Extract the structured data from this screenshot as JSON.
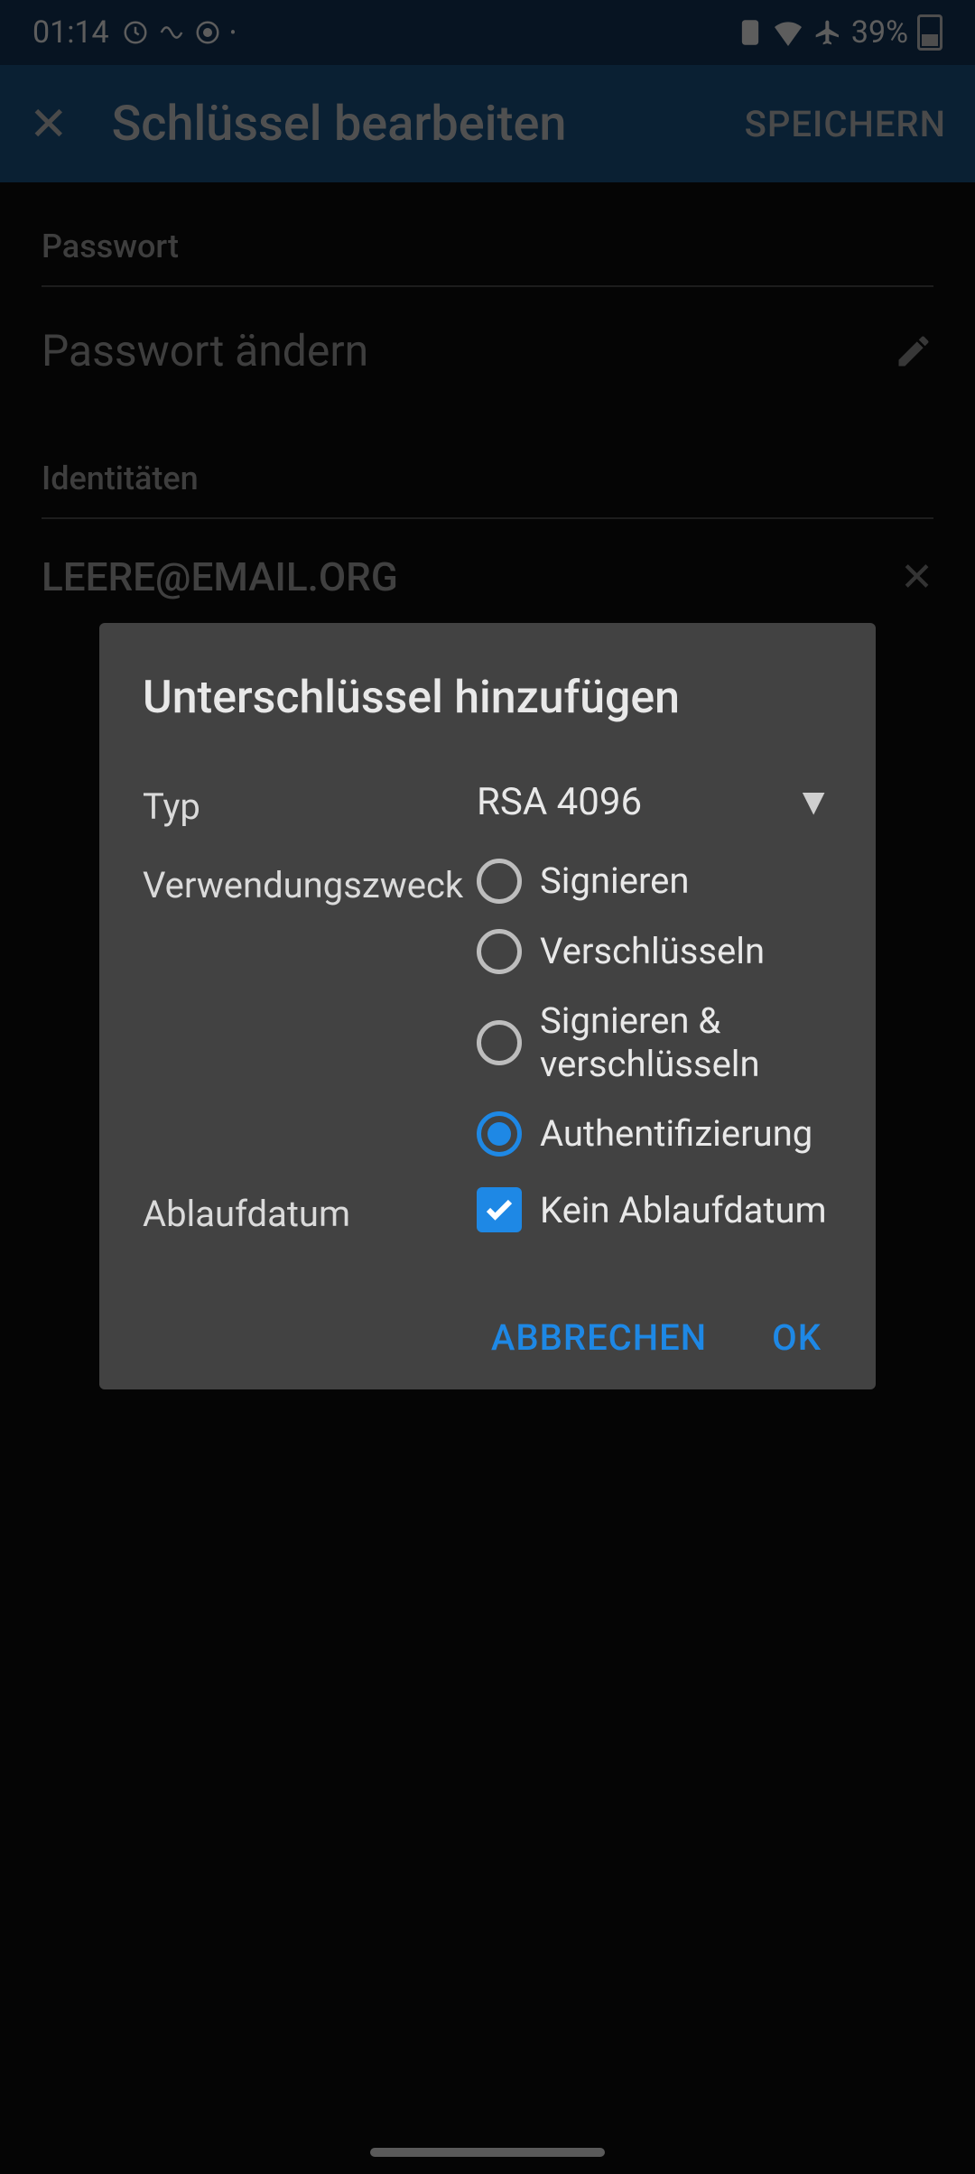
{
  "status": {
    "time": "01:14",
    "battery_pct": "39%"
  },
  "header": {
    "title": "Schlüssel bearbeiten",
    "save": "SPEICHERN"
  },
  "sections": {
    "password_label": "Passwort",
    "change_password": "Passwort ändern",
    "identities_label": "Identitäten",
    "identity_email": "LEERE@EMAIL.ORG"
  },
  "dialog": {
    "title": "Unterschlüssel hinzufügen",
    "type_label": "Typ",
    "type_value": "RSA 4096",
    "usage_label": "Verwendungszweck",
    "usage_options": [
      {
        "label": "Signieren",
        "checked": false
      },
      {
        "label": "Verschlüsseln",
        "checked": false
      },
      {
        "label": "Signieren & verschlüsseln",
        "checked": false
      },
      {
        "label": "Authentifizierung",
        "checked": true
      }
    ],
    "expiry_label": "Ablaufdatum",
    "no_expiry_label": "Kein Ablaufdatum",
    "no_expiry_checked": true,
    "cancel": "ABBRECHEN",
    "ok": "OK"
  }
}
